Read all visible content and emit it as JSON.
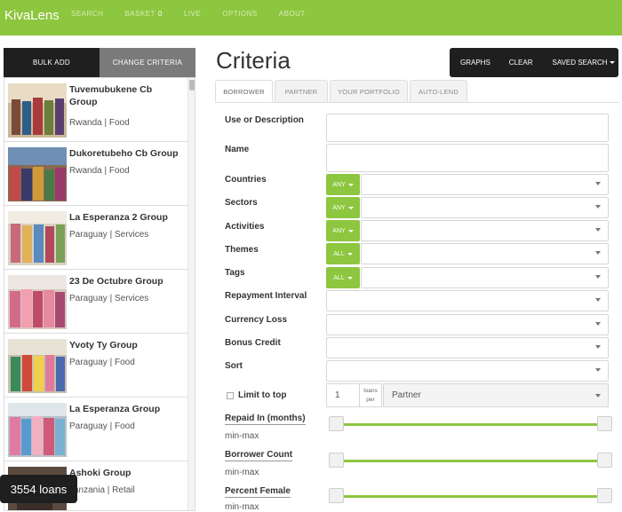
{
  "nav": {
    "brand": "KivaLens",
    "search": "SEARCH",
    "basket": "BASKET",
    "basket_count": "0",
    "live": "LIVE",
    "options": "OPTIONS",
    "about": "ABOUT"
  },
  "left": {
    "bulk_add": "BULK ADD",
    "change_criteria": "CHANGE CRITERIA",
    "loan_count": "3554 loans",
    "loans": [
      {
        "name": "Tuvemubukene Cb Group",
        "meta": "Rwanda | Food"
      },
      {
        "name": "Dukoretubeho Cb Group",
        "meta": "Rwanda | Food"
      },
      {
        "name": "La Esperanza 2 Group",
        "meta": "Paraguay | Services"
      },
      {
        "name": "23 De Octubre Group",
        "meta": "Paraguay | Services"
      },
      {
        "name": "Yvoty Ty Group",
        "meta": "Paraguay | Food"
      },
      {
        "name": "La Esperanza Group",
        "meta": "Paraguay | Food"
      },
      {
        "name": "Ashoki Group",
        "meta": "Tanzania | Retail"
      }
    ]
  },
  "main": {
    "title": "Criteria",
    "tools": {
      "graphs": "GRAPHS",
      "clear": "CLEAR",
      "saved_search": "SAVED SEARCH"
    },
    "tabs": [
      "BORROWER",
      "PARTNER",
      "YOUR PORTFOLIO",
      "AUTO-LEND"
    ],
    "fields": {
      "use": "Use or Description",
      "name": "Name",
      "countries": "Countries",
      "sectors": "Sectors",
      "activities": "Activities",
      "themes": "Themes",
      "tags": "Tags",
      "repayment_interval": "Repayment Interval",
      "currency_loss": "Currency Loss",
      "bonus_credit": "Bonus Credit",
      "sort": "Sort"
    },
    "modes": {
      "countries": "ANY",
      "sectors": "ANY",
      "activities": "ANY",
      "themes": "ALL",
      "tags": "ALL"
    },
    "limit": {
      "label": "Limit to top",
      "value": "1",
      "loans_per": "loans per",
      "per_option": "Partner"
    },
    "sliders": [
      {
        "label": "Repaid In (months)",
        "value": "min-max"
      },
      {
        "label": "Borrower Count",
        "value": "min-max"
      },
      {
        "label": "Percent Female",
        "value": "min-max"
      }
    ]
  },
  "colors": {
    "accent": "#8dc63f",
    "dark": "#1f1f1f"
  }
}
